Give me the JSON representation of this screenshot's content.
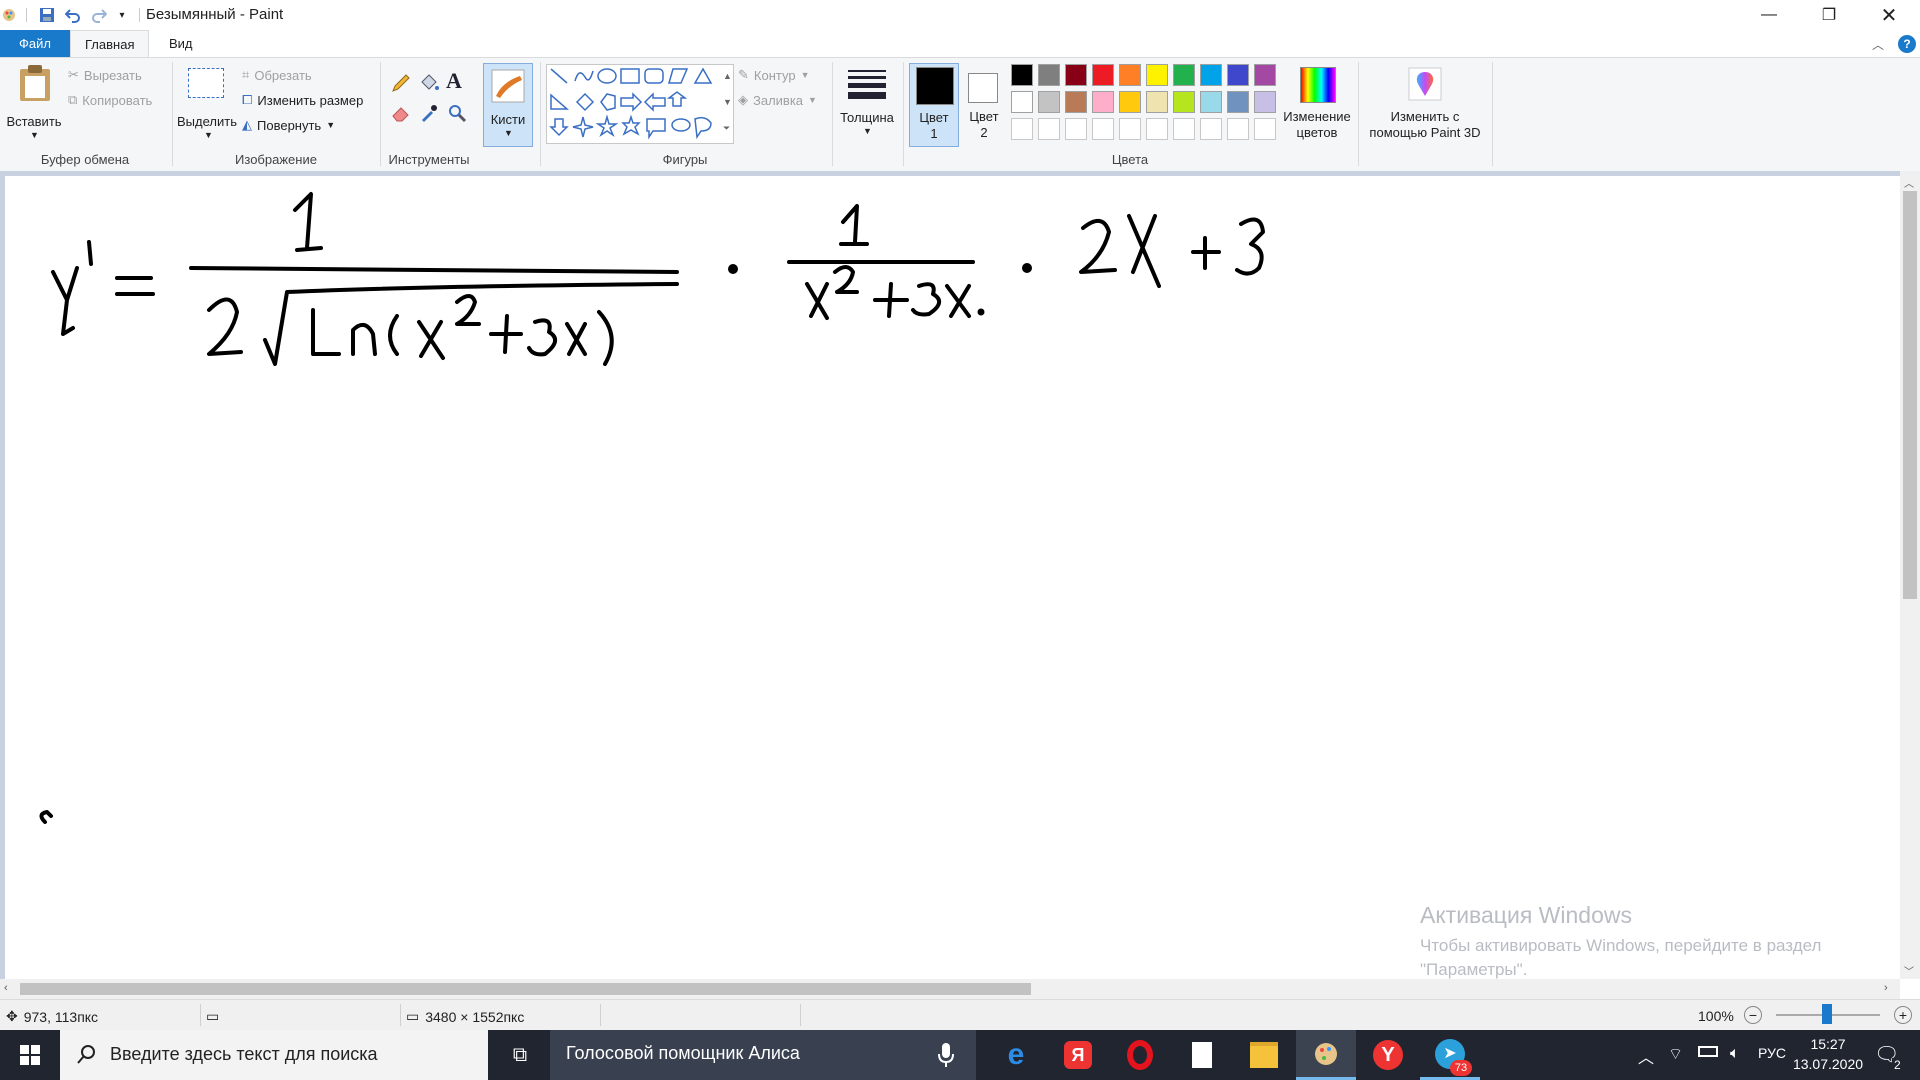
{
  "window": {
    "title": "Безымянный - Paint",
    "minimize_icon": "minimize-icon",
    "restore_icon": "restore-icon",
    "close_icon": "close-icon"
  },
  "tabs": {
    "file": "Файл",
    "home": "Главная",
    "view": "Вид"
  },
  "ribbon": {
    "clipboard": {
      "paste": "Вставить",
      "cut": "Вырезать",
      "copy": "Копировать",
      "group_label": "Буфер обмена"
    },
    "image": {
      "select": "Выделить",
      "crop": "Обрезать",
      "resize": "Изменить размер",
      "rotate": "Повернуть",
      "group_label": "Изображение"
    },
    "tools": {
      "group_label": "Инструменты"
    },
    "brushes": {
      "label": "Кисти"
    },
    "shapes": {
      "outline": "Контур",
      "fill": "Заливка",
      "group_label": "Фигуры"
    },
    "size": {
      "label": "Толщина"
    },
    "colors": {
      "color1_line1": "Цвет",
      "color1_line2": "1",
      "color2_line1": "Цвет",
      "color2_line2": "2",
      "edit_line1": "Изменение",
      "edit_line2": "цветов",
      "paint3d_line1": "Изменить с",
      "paint3d_line2": "помощью Paint 3D",
      "group_label": "Цвета",
      "palette_row1": [
        "#000000",
        "#7f7f7f",
        "#880015",
        "#ed1c24",
        "#ff7f27",
        "#fff200",
        "#22b14c",
        "#00a2e8",
        "#3f48cc",
        "#a349a4"
      ],
      "palette_row2": [
        "#ffffff",
        "#c3c3c3",
        "#b97a57",
        "#ffaec9",
        "#ffc90e",
        "#efe4b0",
        "#b5e61d",
        "#99d9ea",
        "#7092be",
        "#c8bfe7"
      ]
    }
  },
  "status": {
    "cursor_pos": "973, 113пкс",
    "image_size": "3480 × 1552пкс",
    "zoom": "100%"
  },
  "activation": {
    "title": "Активация Windows",
    "line1": "Чтобы активировать Windows, перейдите в раздел",
    "line2": "\"Параметры\"."
  },
  "taskbar": {
    "search_placeholder": "Введите здесь текст для поиска",
    "alice": "Голосовой помощник Алиса",
    "lang": "РУС",
    "time": "15:27",
    "date": "13.07.2020",
    "telegram_badge": "73",
    "notifications_badge": "2"
  }
}
